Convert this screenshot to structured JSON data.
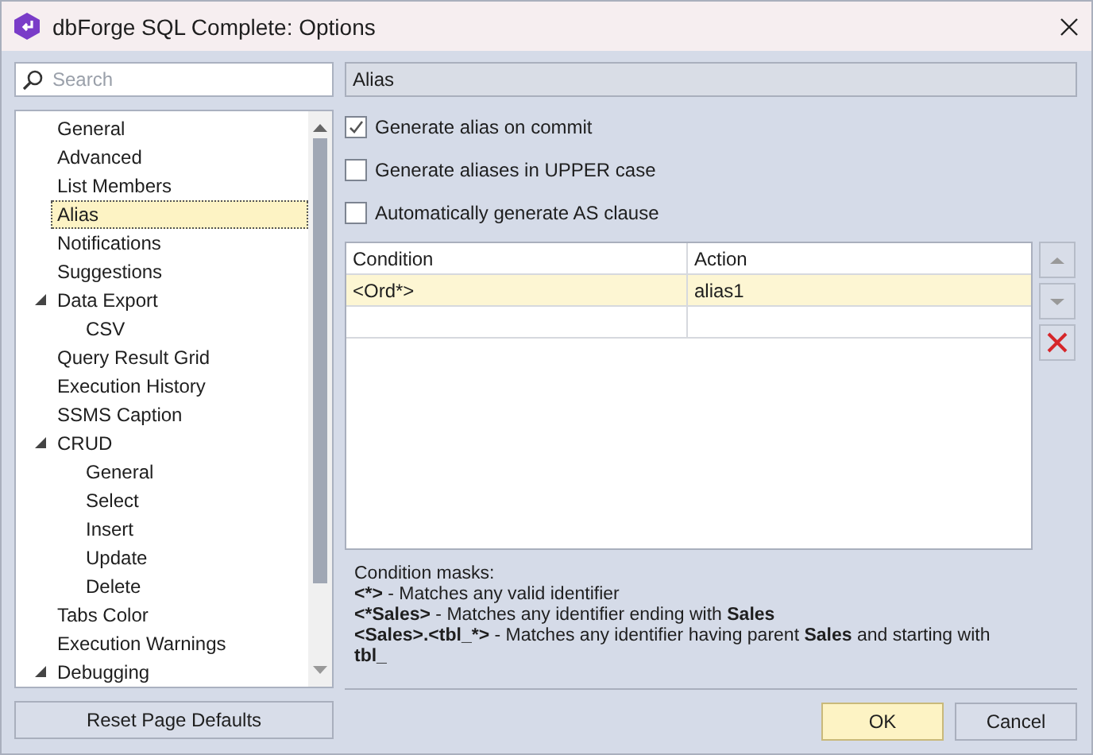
{
  "window": {
    "title": "dbForge SQL Complete: Options"
  },
  "search": {
    "placeholder": "Search"
  },
  "tree": [
    {
      "label": "General",
      "selected": false
    },
    {
      "label": "Advanced",
      "selected": false
    },
    {
      "label": "List Members",
      "selected": false
    },
    {
      "label": "Alias",
      "selected": true
    },
    {
      "label": "Notifications",
      "selected": false
    },
    {
      "label": "Suggestions",
      "selected": false
    },
    {
      "label": "Data Export",
      "selected": false,
      "expanded": true,
      "children": [
        {
          "label": "CSV",
          "selected": false
        }
      ]
    },
    {
      "label": "Query Result Grid",
      "selected": false
    },
    {
      "label": "Execution History",
      "selected": false
    },
    {
      "label": "SSMS Caption",
      "selected": false
    },
    {
      "label": "CRUD",
      "selected": false,
      "expanded": true,
      "children": [
        {
          "label": "General",
          "selected": false
        },
        {
          "label": "Select",
          "selected": false
        },
        {
          "label": "Insert",
          "selected": false
        },
        {
          "label": "Update",
          "selected": false
        },
        {
          "label": "Delete",
          "selected": false
        }
      ]
    },
    {
      "label": "Tabs Color",
      "selected": false
    },
    {
      "label": "Execution Warnings",
      "selected": false
    },
    {
      "label": "Debugging",
      "selected": false,
      "expanded": true
    }
  ],
  "reset_button": "Reset Page Defaults",
  "page_title": "Alias",
  "options": [
    {
      "label": "Generate alias on commit",
      "checked": true
    },
    {
      "label": "Generate aliases in UPPER case",
      "checked": false
    },
    {
      "label": "Automatically generate AS clause",
      "checked": false
    }
  ],
  "table": {
    "columns": [
      "Condition",
      "Action"
    ],
    "rows": [
      {
        "cells": [
          "<Ord*>",
          "alias1"
        ],
        "selected": true
      }
    ]
  },
  "masks": {
    "title": "Condition masks:",
    "lines": [
      "**<*>** - Matches any valid identifier",
      "**<*Sales>** - Matches any identifier ending with **Sales**",
      "**<Sales>.<tbl_*>** - Matches any identifier having parent **Sales** and starting with **tbl_**"
    ]
  },
  "buttons": [
    {
      "label": "OK",
      "kind": "default"
    },
    {
      "label": "Cancel",
      "kind": "normal"
    }
  ]
}
